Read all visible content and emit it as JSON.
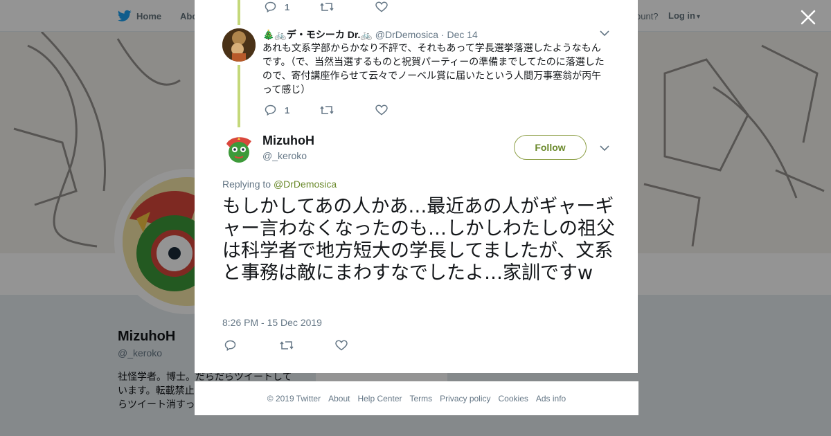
{
  "colors": {
    "accent": "#8fa14a",
    "link": "#6b8a2c",
    "thread_line": "#c4d87a",
    "muted": "#657786"
  },
  "bg": {
    "nav": {
      "home_label": "Home",
      "about_label": "Abo",
      "account_text": "ccount?",
      "login_label": "Log in"
    },
    "profile": {
      "name": "MizuhoH",
      "handle": "@_keroko",
      "bio": "社怪学者。博士。だらだらツイートしています。転載禁止 …たち」(青弓社)ア… らツイート消すっては。"
    },
    "card_label": "Ads info"
  },
  "modal": {
    "top_actions": {
      "reply_count": "1",
      "reply_icon": "reply-icon",
      "retweet_icon": "retweet-icon",
      "like_icon": "heart-icon"
    },
    "reply_tweet": {
      "name": "🎄🚲デ・モシーカ Dr.🚲",
      "handle": "@DrDemosica",
      "dot": "·",
      "date": "Dec 14",
      "text": "あれも文系学部からかなり不評で、それもあって学長選挙落選したようなもんです。（で、当然当選するものと祝賀パーティーの準備までしてたのに落選したので、寄付講座作らせて云々でノーベル賞に届いたという人間万事塞翁が丙午って感じ）",
      "reply_count": "1"
    },
    "main_tweet": {
      "name": "MizuhoH",
      "handle": "@_keroko",
      "follow_label": "Follow",
      "replying_prefix": "Replying to",
      "replying_to": "@DrDemosica",
      "text": "もしかしてあの人かあ…最近あの人がギャーギャー言わなくなったのも…しかしわたしの祖父は科学者で地方短大の学長してましたが、文系と事務は敵にまわすなでしたよ…家訓ですw",
      "timestamp": "8:26 PM - 15 Dec 2019"
    }
  },
  "footer": {
    "links": [
      "© 2019 Twitter",
      "About",
      "Help Center",
      "Terms",
      "Privacy policy",
      "Cookies",
      "Ads info"
    ]
  }
}
